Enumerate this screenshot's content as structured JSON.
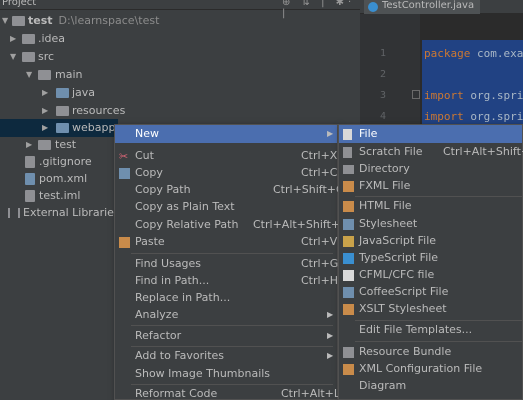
{
  "project_panel": {
    "title": "Project",
    "tools": "⊕ ⇅ | ✱· |",
    "tree": [
      {
        "name": "test",
        "path": "D:\\learnspace\\test",
        "arrow": "▼"
      },
      {
        "name": ".idea",
        "arrow": "▶"
      },
      {
        "name": "src",
        "arrow": "▼"
      },
      {
        "name": "main",
        "arrow": "▼"
      },
      {
        "name": "java",
        "arrow": "▶"
      },
      {
        "name": "resources",
        "arrow": "▶"
      },
      {
        "name": "webapp",
        "arrow": "▶"
      },
      {
        "name": "test",
        "arrow": "▶"
      },
      {
        "name": ".gitignore"
      },
      {
        "name": "pom.xml"
      },
      {
        "name": "test.iml"
      },
      {
        "name": "External Libraries"
      }
    ]
  },
  "editor": {
    "tab_label": "TestController.java",
    "line_numbers": [
      "1",
      "2",
      "3",
      "4"
    ],
    "code": [
      {
        "kw": "package",
        "rest": " com.exa"
      },
      {
        "kw": "",
        "rest": ""
      },
      {
        "kw": "import",
        "rest": " org.spri"
      },
      {
        "kw": "import",
        "rest": " org.spri"
      }
    ]
  },
  "context_menu": {
    "items": [
      {
        "label": "New",
        "shortcut": "",
        "submenu": true
      },
      {
        "label": "Cut",
        "shortcut": "Ctrl+X"
      },
      {
        "label": "Copy",
        "shortcut": "Ctrl+C"
      },
      {
        "label": "Copy Path",
        "shortcut": "Ctrl+Shift+C"
      },
      {
        "label": "Copy as Plain Text",
        "shortcut": ""
      },
      {
        "label": "Copy Relative Path",
        "shortcut": "Ctrl+Alt+Shift+C"
      },
      {
        "label": "Paste",
        "shortcut": "Ctrl+V"
      },
      {
        "label": "Find Usages",
        "shortcut": "Ctrl+G"
      },
      {
        "label": "Find in Path...",
        "shortcut": "Ctrl+H"
      },
      {
        "label": "Replace in Path...",
        "shortcut": ""
      },
      {
        "label": "Analyze",
        "shortcut": "",
        "submenu": true
      },
      {
        "label": "Refactor",
        "shortcut": "",
        "submenu": true
      },
      {
        "label": "Add to Favorites",
        "shortcut": "",
        "submenu": true
      },
      {
        "label": "Show Image Thumbnails",
        "shortcut": ""
      },
      {
        "label": "Reformat Code",
        "shortcut": "Ctrl+Alt+L"
      }
    ]
  },
  "new_submenu": {
    "items": [
      {
        "label": "File",
        "shortcut": ""
      },
      {
        "label": "Scratch File",
        "shortcut": "Ctrl+Alt+Shift+Ins"
      },
      {
        "label": "Directory",
        "shortcut": ""
      },
      {
        "label": "FXML File",
        "shortcut": ""
      },
      {
        "label": "HTML File",
        "shortcut": ""
      },
      {
        "label": "Stylesheet",
        "shortcut": ""
      },
      {
        "label": "JavaScript File",
        "shortcut": ""
      },
      {
        "label": "TypeScript File",
        "shortcut": ""
      },
      {
        "label": "CFML/CFC file",
        "shortcut": ""
      },
      {
        "label": "CoffeeScript File",
        "shortcut": ""
      },
      {
        "label": "XSLT Stylesheet",
        "shortcut": ""
      },
      {
        "label": "Edit File Templates...",
        "shortcut": ""
      },
      {
        "label": "Resource Bundle",
        "shortcut": ""
      },
      {
        "label": "XML Configuration File",
        "shortcut": "",
        "submenu": true
      },
      {
        "label": "Diagram",
        "shortcut": "",
        "submenu": true
      }
    ]
  },
  "colors": {
    "menu_bg": "#3c3f41",
    "menu_highlight": "#4b6eaf",
    "selection_row": "#0d293e",
    "editor_bg": "#2b2b2b",
    "code_selection": "#214283",
    "keyword": "#cc7832"
  },
  "icons": {
    "cut": "scissors-icon",
    "copy": "copy-icon",
    "paste": "clipboard-icon",
    "submenu": "chevron-right-icon"
  }
}
